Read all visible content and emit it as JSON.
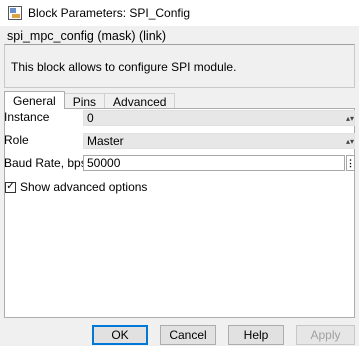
{
  "window": {
    "title": "Block Parameters: SPI_Config",
    "icon": "simulink-block-icon"
  },
  "mask_header": "spi_mpc_config (mask) (link)",
  "description": "This block allows to configure SPI module.",
  "tabs": [
    {
      "label": "General",
      "active": true
    },
    {
      "label": "Pins",
      "active": false
    },
    {
      "label": "Advanced",
      "active": false
    }
  ],
  "params": {
    "instance": {
      "label": "Instance",
      "value": "0"
    },
    "role": {
      "label": "Role",
      "value": "Master"
    },
    "baud_rate": {
      "label": "Baud Rate, bps",
      "value": "50000"
    }
  },
  "show_advanced": {
    "label": "Show advanced options",
    "checked": true,
    "mark": "✓"
  },
  "buttons": {
    "ok": "OK",
    "cancel": "Cancel",
    "help": "Help",
    "apply": "Apply"
  },
  "glyphs": {
    "dropdown": "▴▾",
    "more": "⋮"
  }
}
